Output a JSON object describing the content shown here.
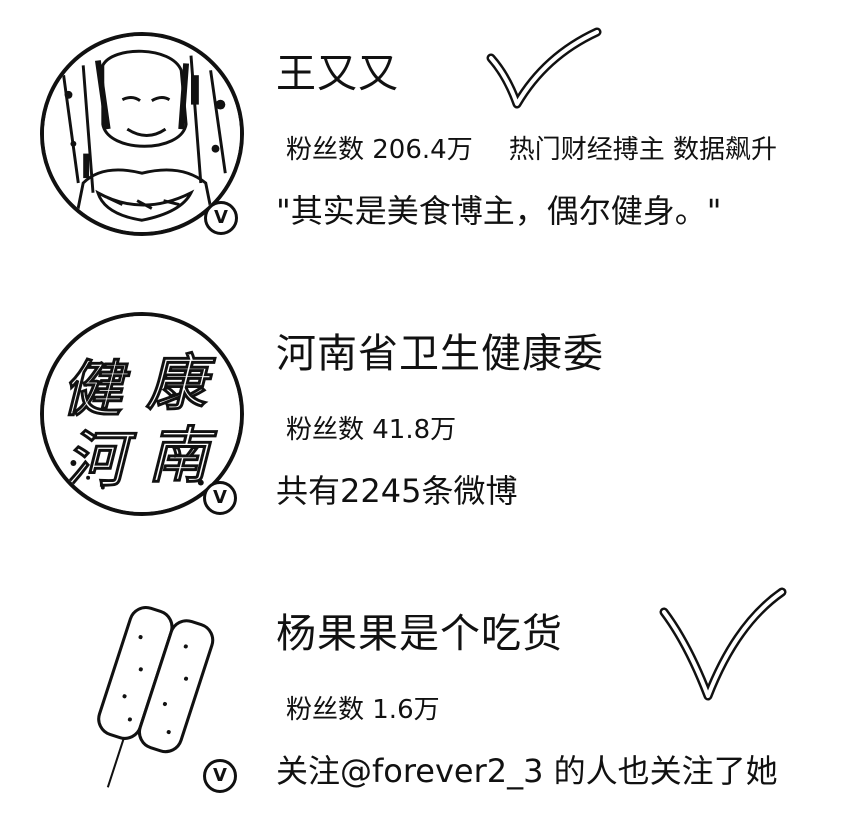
{
  "users": [
    {
      "name": "王又又",
      "followers_label": "粉丝数 206.4万",
      "tags": "热门财经搏主 数据飙升",
      "desc": "\"其实是美食博主，偶尔健身。\"",
      "verified_mark": "V",
      "has_checkmark": true
    },
    {
      "name": "河南省卫生健康委",
      "followers_label": "粉丝数 41.8万",
      "tags": "",
      "desc": "共有2245条微博",
      "verified_mark": "V",
      "avatar_text": [
        "健",
        "康",
        "河",
        "南"
      ],
      "has_checkmark": false
    },
    {
      "name": "杨果果是个吃货",
      "followers_label": "粉丝数 1.6万",
      "tags": "",
      "desc": "关注@forever2_3 的人也关注了她",
      "verified_mark": "V",
      "has_checkmark": true
    }
  ]
}
